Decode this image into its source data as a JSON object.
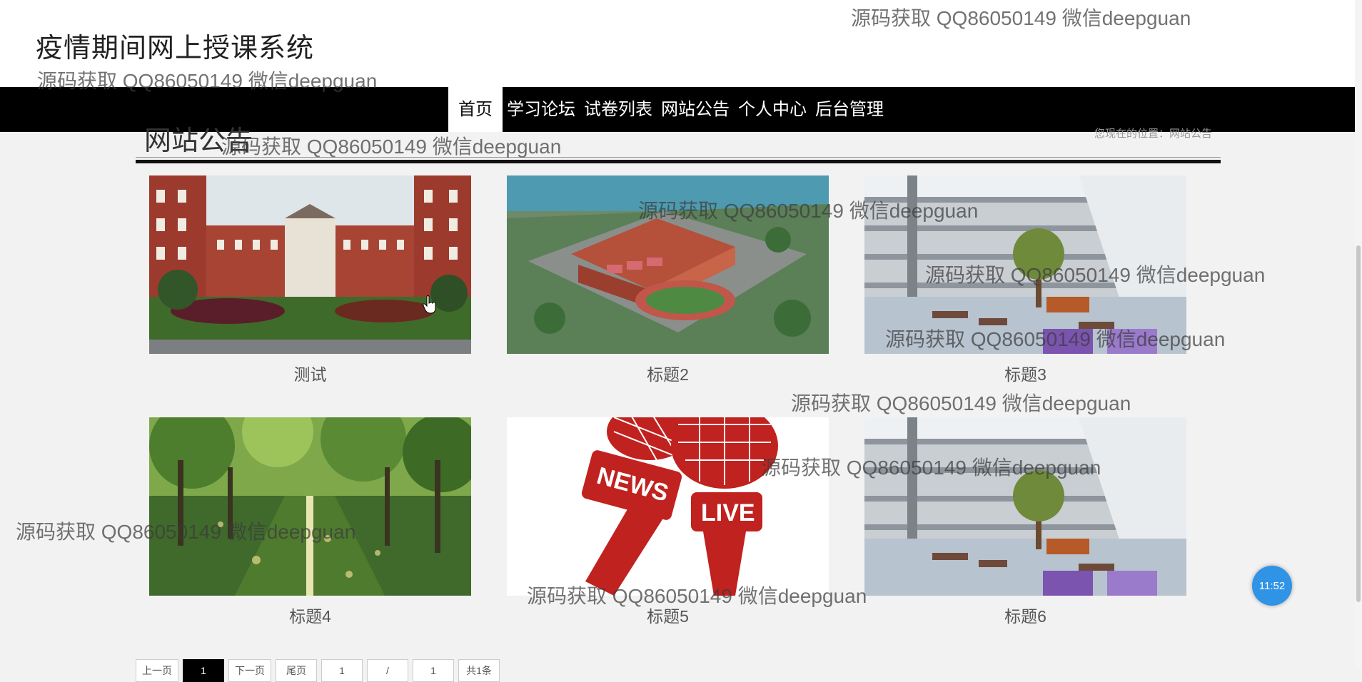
{
  "header": {
    "site_title": "疫情期间网上授课系统"
  },
  "nav": {
    "items": [
      {
        "label": "首页",
        "active": true
      },
      {
        "label": "学习论坛",
        "active": false
      },
      {
        "label": "试卷列表",
        "active": false
      },
      {
        "label": "网站公告",
        "active": false
      },
      {
        "label": "个人中心",
        "active": false
      },
      {
        "label": "后台管理",
        "active": false
      }
    ]
  },
  "section": {
    "title": "网站公告",
    "breadcrumb": "您现在的位置：网站公告"
  },
  "cards": [
    {
      "caption": "测试",
      "image": "school-building-photo"
    },
    {
      "caption": "标题2",
      "image": "campus-aerial-render"
    },
    {
      "caption": "标题3",
      "image": "modern-courtyard-render"
    },
    {
      "caption": "标题4",
      "image": "tree-lined-path-photo"
    },
    {
      "caption": "标题5",
      "image": "news-live-microphones-graphic"
    },
    {
      "caption": "标题6",
      "image": "modern-courtyard-render"
    }
  ],
  "pagination": {
    "items": [
      "上一页",
      "1",
      "下一页",
      "尾页",
      "1",
      "/",
      "1",
      "共1条"
    ],
    "current": "1"
  },
  "watermark": {
    "text": "源码获取 QQ86050149 微信deepguan"
  },
  "timer": {
    "label": "11:52"
  },
  "colors": {
    "nav_bg": "#000000",
    "accent": "#2f93e6",
    "page_bg": "#f2f2f2"
  }
}
